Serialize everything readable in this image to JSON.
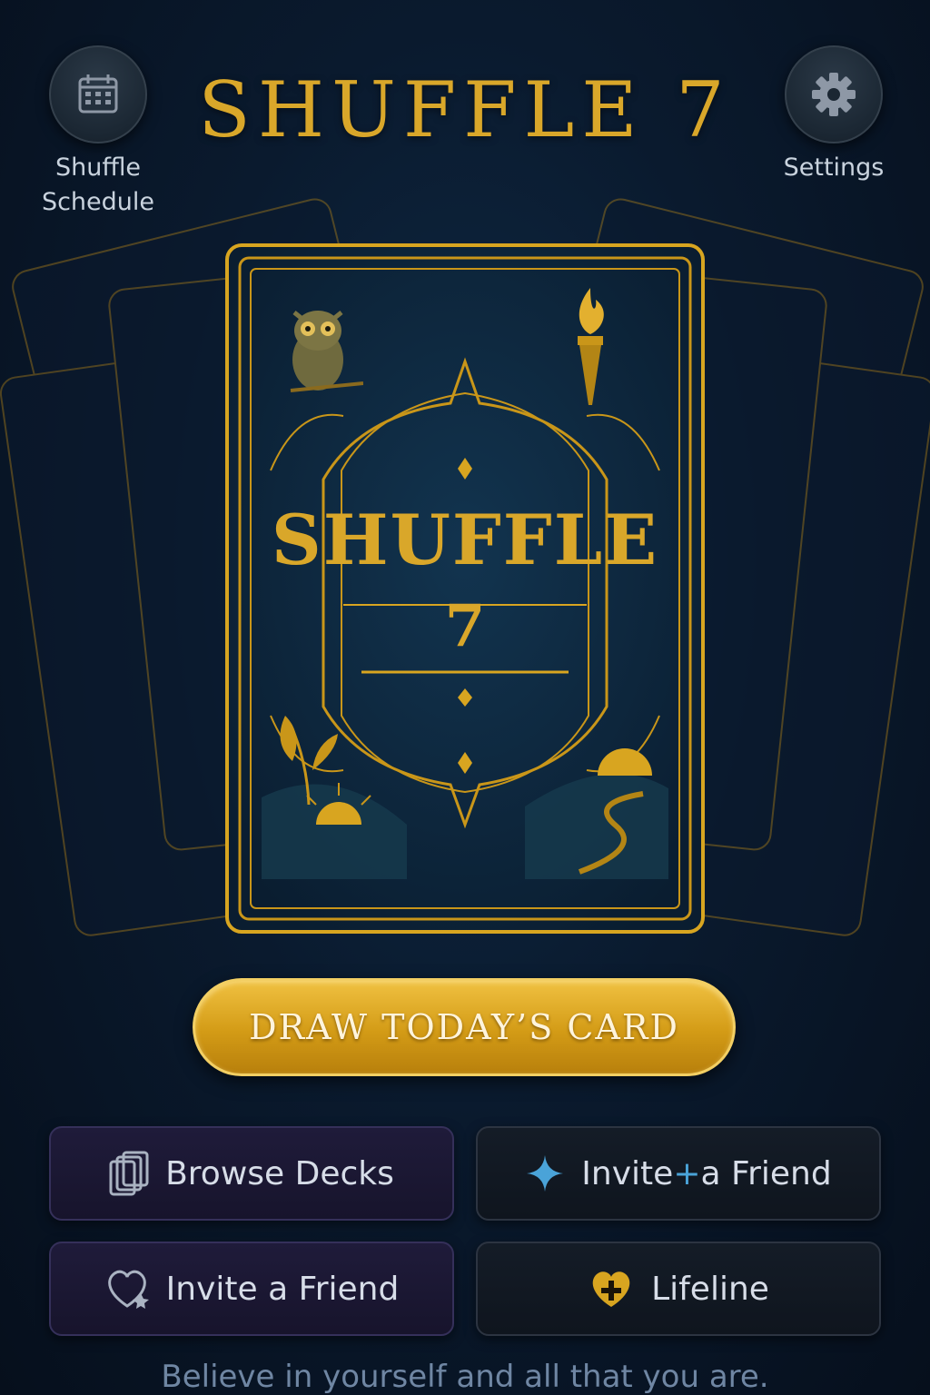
{
  "header": {
    "title": "SHUFFLE 7",
    "left_button": {
      "label_line1": "Shuffle",
      "label_line2": "Schedule",
      "icon": "calendar-icon"
    },
    "right_button": {
      "label": "Settings",
      "icon": "gear-icon"
    }
  },
  "card": {
    "title_line1": "SHUFFLE",
    "title_line2": "7",
    "illustrations": [
      "owl-icon",
      "torch-icon",
      "leaf-icon",
      "sun-icon",
      "path-icon"
    ]
  },
  "primary_action": {
    "label": "DRAW TODAY’S CARD"
  },
  "tiles": [
    {
      "label": "Browse Decks",
      "icon": "cards-stack-icon"
    },
    {
      "label_left": "Invite",
      "label_plus": "+",
      "label_right": "a Friend",
      "icon": "sparkle-icon"
    },
    {
      "label": "Invite a Friend",
      "icon": "heart-outline-icon"
    },
    {
      "label": "Lifeline",
      "icon": "heart-plus-icon"
    }
  ],
  "footer": {
    "quote": "Believe in yourself and all that you are."
  },
  "colors": {
    "gold": "#d9a72a",
    "background": "#0a1a2e",
    "accent_blue": "#4aa3d8"
  }
}
